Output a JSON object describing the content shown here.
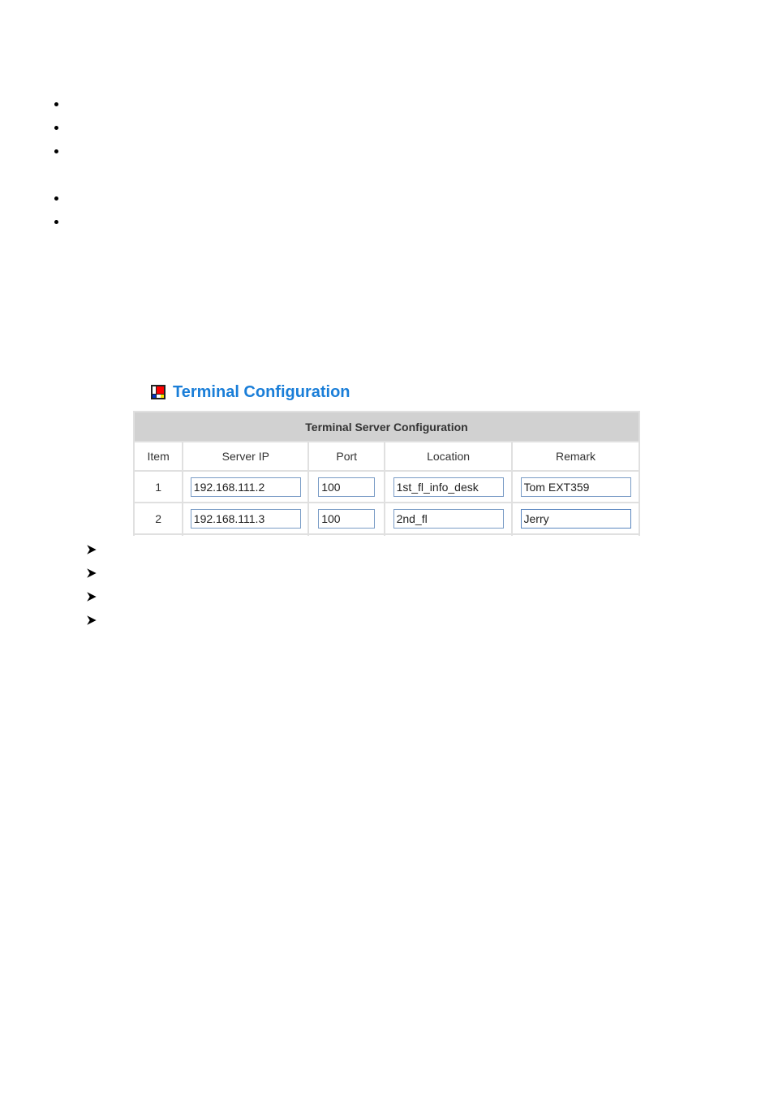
{
  "document": {
    "top_bullets": [
      "",
      "",
      "",
      "",
      ""
    ],
    "arrow_bullets": [
      "",
      "",
      "",
      ""
    ]
  },
  "terminal_config": {
    "title": "Terminal Configuration",
    "icon": "mondrian-config-icon",
    "accent_color": "#1a7ed8",
    "table": {
      "caption": "Terminal Server Configuration",
      "columns": [
        "Item",
        "Server IP",
        "Port",
        "Location",
        "Remark"
      ],
      "rows": [
        {
          "item": "1",
          "server_ip": "192.168.111.2",
          "port": "100",
          "location": "1st_fl_info_desk",
          "remark": "Tom EXT359"
        },
        {
          "item": "2",
          "server_ip": "192.168.111.3",
          "port": "100",
          "location": "2nd_fl",
          "remark": "Jerry"
        }
      ],
      "focused_field": "rows.1.remark"
    }
  }
}
